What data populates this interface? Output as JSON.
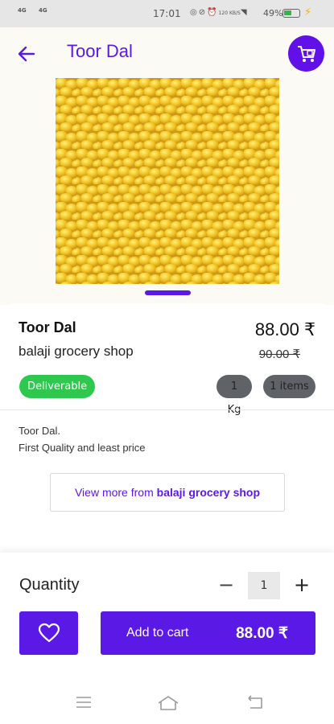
{
  "status_bar": {
    "signal_left": "4G",
    "signal_right": "4G",
    "time": "17:01",
    "data_rate": "120 KB/S",
    "battery": "49%",
    "colors": {
      "battery_fill": "#38b24a",
      "bolt": "#f4b400"
    }
  },
  "header": {
    "title": "Toor Dal",
    "back_icon": "arrow-left-icon",
    "cart_icon": "shopping-cart-icon"
  },
  "product": {
    "image_icon": "toor-dal-image",
    "name": "Toor Dal",
    "shop": "balaji grocery shop",
    "price": "88.00 ₹",
    "old_price": "90.00 ₹",
    "badge": "Deliverable",
    "chips": [
      "1 Kg",
      "1 items"
    ],
    "description_line1": "Toor Dal.",
    "description_line2": "First Quality and least price",
    "view_more_prefix": "View more from ",
    "view_more_shop": "balaji grocery shop"
  },
  "quantity": {
    "label": "Quantity",
    "minus": "−",
    "value": "1",
    "plus": "+"
  },
  "actions": {
    "wishlist_icon": "heart-icon",
    "add_to_cart_label": "Add to cart",
    "add_to_cart_amount": "88.00 ₹"
  },
  "nav": [
    "menu-icon",
    "home-icon",
    "back-icon"
  ],
  "colors": {
    "accent": "#5b19e6",
    "deliverable": "#2ec84f",
    "chip": "#5f6368"
  }
}
